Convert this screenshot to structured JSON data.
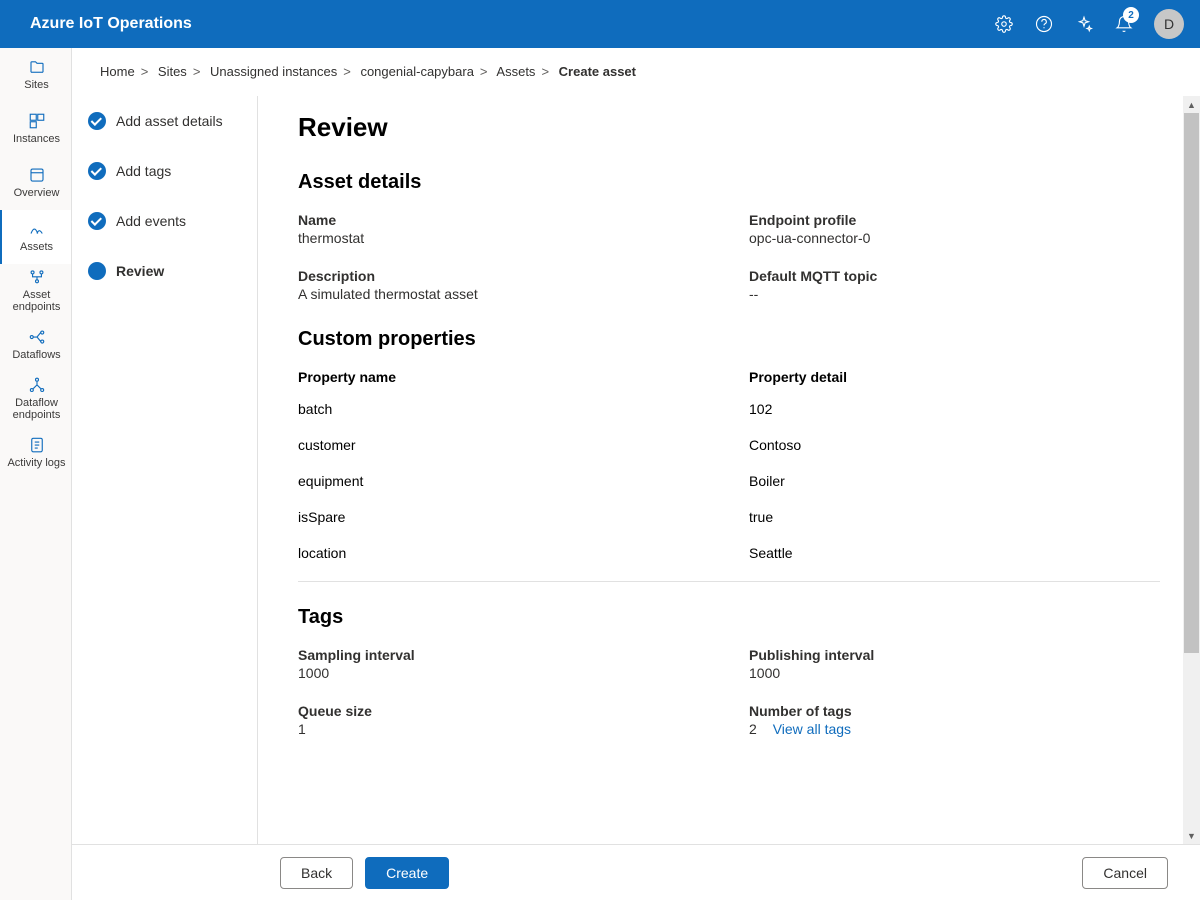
{
  "brand": "Azure IoT Operations",
  "notifications": {
    "count": "2"
  },
  "avatar": {
    "initial": "D"
  },
  "sidebar": {
    "items": [
      {
        "label": "Sites"
      },
      {
        "label": "Instances"
      },
      {
        "label": "Overview"
      },
      {
        "label": "Assets"
      },
      {
        "label": "Asset endpoints"
      },
      {
        "label": "Dataflows"
      },
      {
        "label": "Dataflow endpoints"
      },
      {
        "label": "Activity logs"
      }
    ]
  },
  "breadcrumbs": {
    "items": [
      "Home",
      "Sites",
      "Unassigned instances",
      "congenial-capybara",
      "Assets"
    ],
    "current": "Create asset"
  },
  "steps": {
    "items": [
      {
        "label": "Add asset details"
      },
      {
        "label": "Add tags"
      },
      {
        "label": "Add events"
      },
      {
        "label": "Review"
      }
    ]
  },
  "page": {
    "title": "Review",
    "asset_details": {
      "heading": "Asset details",
      "name_label": "Name",
      "name_value": "thermostat",
      "endpoint_label": "Endpoint profile",
      "endpoint_value": "opc-ua-connector-0",
      "description_label": "Description",
      "description_value": "A simulated thermostat asset",
      "mqtt_label": "Default MQTT topic",
      "mqtt_value": "--"
    },
    "custom_props": {
      "heading": "Custom properties",
      "col_name": "Property name",
      "col_detail": "Property detail",
      "rows": [
        {
          "name": "batch",
          "detail": "102"
        },
        {
          "name": "customer",
          "detail": "Contoso"
        },
        {
          "name": "equipment",
          "detail": "Boiler"
        },
        {
          "name": "isSpare",
          "detail": "true"
        },
        {
          "name": "location",
          "detail": "Seattle"
        }
      ]
    },
    "tags": {
      "heading": "Tags",
      "sampling_label": "Sampling interval",
      "sampling_value": "1000",
      "publishing_label": "Publishing interval",
      "publishing_value": "1000",
      "queue_label": "Queue size",
      "queue_value": "1",
      "count_label": "Number of tags",
      "count_value": "2",
      "view_all": "View all tags"
    }
  },
  "footer": {
    "back": "Back",
    "create": "Create",
    "cancel": "Cancel"
  }
}
